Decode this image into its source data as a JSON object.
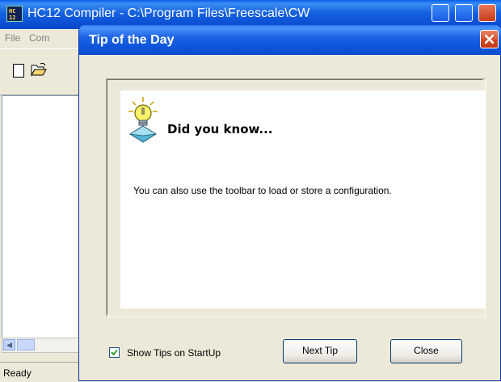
{
  "main_window": {
    "title": "HC12 Compiler - C:\\Program Files\\Freescale\\CW",
    "menu": [
      "File",
      "Com"
    ],
    "status": "Ready",
    "toolbar_icons": [
      "new-document-icon",
      "open-folder-icon"
    ]
  },
  "dialog": {
    "title": "Tip of the Day",
    "heading": "Did you know...",
    "tip": "You can also use the toolbar to load or store a configuration.",
    "checkbox_label": "Show Tips on StartUp",
    "checkbox_checked": true,
    "next_tip_label": "Next Tip",
    "close_label": "Close",
    "icon": "lightbulb-icon"
  },
  "colors": {
    "titlebar_blue": "#0a5ee8",
    "close_red": "#d24725",
    "dialog_face": "#ece9d8"
  }
}
